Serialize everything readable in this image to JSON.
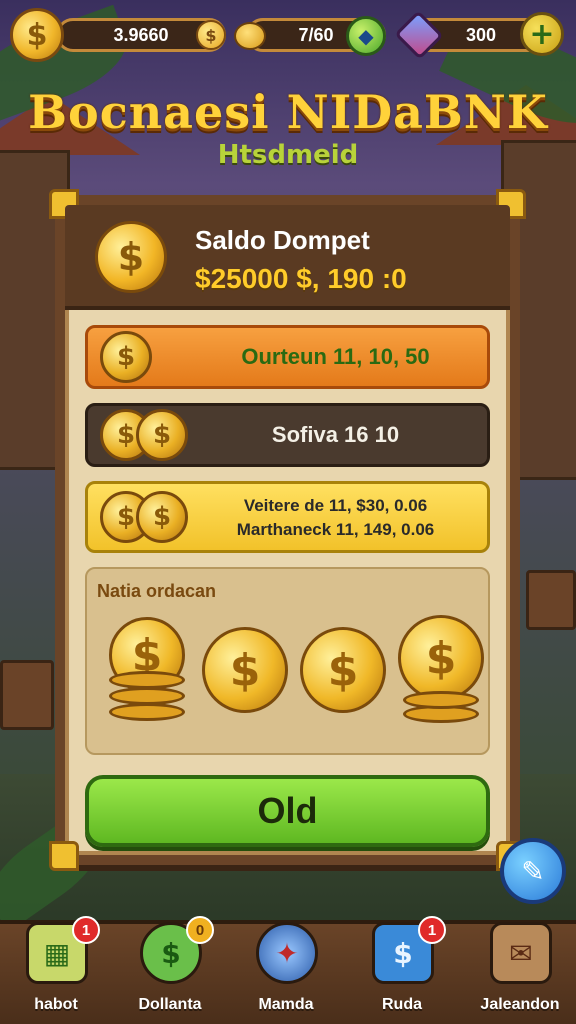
{
  "topbar": {
    "coins_value": "3.9660",
    "coins_icon": "dollar-coin-icon",
    "gold_value": "7/60",
    "gems_value": "300",
    "plus_label": "+"
  },
  "header": {
    "title": "Bocnaesi NIDaBNK",
    "subtitle": "Htsdmeid"
  },
  "wallet": {
    "label": "Saldo Dompet",
    "amount": "$25000 $, 190 :0",
    "coin_symbol": "$"
  },
  "rows": {
    "orange_text": "Ourteun 11, 10, 50",
    "dark_text": "Sofiva 16 10",
    "yellow_line1": "Veitere de 11, $30, 0.06",
    "yellow_line2": "Marthaneck 11, 149, 0.06"
  },
  "section": {
    "label": "Natia ordacan"
  },
  "action": {
    "ok_label": "Old"
  },
  "side_button": {
    "icon": "pencil-icon",
    "glyph": "✎"
  },
  "nav": {
    "items": [
      {
        "label": "habot",
        "badge": "1",
        "glyph": "▦"
      },
      {
        "label": "Dollanta",
        "badge": "0",
        "glyph": "$"
      },
      {
        "label": "Mamda",
        "badge": "",
        "glyph": "✦"
      },
      {
        "label": "Ruda",
        "badge": "1",
        "glyph": "$"
      },
      {
        "label": "Jaleandon",
        "badge": "",
        "glyph": "✉"
      }
    ]
  },
  "colors": {
    "accent_gold": "#ffd23a",
    "ok_green": "#5fb822",
    "panel_bg": "#e8d6ae"
  }
}
